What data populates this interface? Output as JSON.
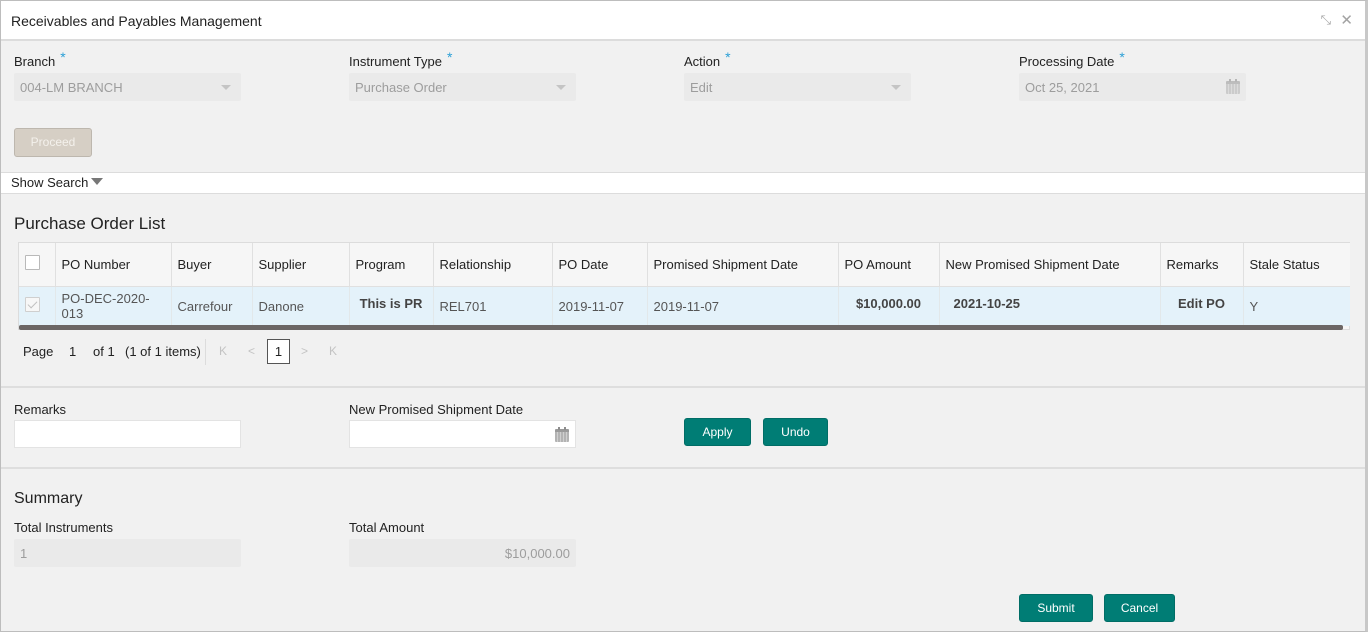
{
  "window": {
    "title": "Receivables and Payables Management",
    "controls": [
      {
        "name": "minimize-icon",
        "glyph": "⤡"
      },
      {
        "name": "close-icon",
        "glyph": "✕"
      }
    ]
  },
  "filters": {
    "branch": {
      "label": "Branch",
      "required": "*",
      "value": "004-LM BRANCH"
    },
    "instrument_type": {
      "label": "Instrument Type",
      "required": "*",
      "value": "Purchase Order"
    },
    "action": {
      "label": "Action",
      "required": "*",
      "value": "Edit"
    },
    "processing_date": {
      "label": "Processing Date",
      "required": "*",
      "value": "Oct 25, 2021"
    },
    "proceed_label": "Proceed"
  },
  "show_search": {
    "label": "Show Search"
  },
  "po_list": {
    "title": "Purchase Order List",
    "columns": [
      "PO Number",
      "Buyer",
      "Supplier",
      "Program",
      "Relationship",
      "PO Date",
      "Promised Shipment Date",
      "PO Amount",
      "New Promised Shipment Date",
      "Remarks",
      "Stale Status"
    ],
    "rows": [
      {
        "selected": true,
        "po_number": "PO-DEC-2020-013",
        "buyer": "Carrefour",
        "supplier": "Danone",
        "program": "This is PR",
        "relationship": "REL701",
        "po_date": "2019-11-07",
        "promised_shipment_date": "2019-11-07",
        "po_amount": "$10,000.00",
        "new_promised_shipment_date": "2021-10-25",
        "remarks": "Edit PO",
        "stale_status": "Y"
      }
    ],
    "pager": {
      "page_label": "Page",
      "page": "1",
      "of_label": "of 1",
      "items": "(1 of 1 items)",
      "current": "1",
      "first": "K",
      "prev": "<",
      "next": ">",
      "last": "K"
    }
  },
  "edit": {
    "remarks_label": "Remarks",
    "remarks_value": "",
    "new_date_label": "New Promised Shipment Date",
    "new_date_value": "",
    "apply_label": "Apply",
    "undo_label": "Undo"
  },
  "summary": {
    "title": "Summary",
    "total_instruments_label": "Total Instruments",
    "total_instruments": "1",
    "total_amount_label": "Total Amount",
    "total_amount": "$10,000.00"
  },
  "footer": {
    "submit_label": "Submit",
    "cancel_label": "Cancel"
  },
  "colors": {
    "primary": "#007d75",
    "required": "#2a9fd6",
    "link": "#1a6ea6",
    "row_selected": "#e4f2fa"
  }
}
